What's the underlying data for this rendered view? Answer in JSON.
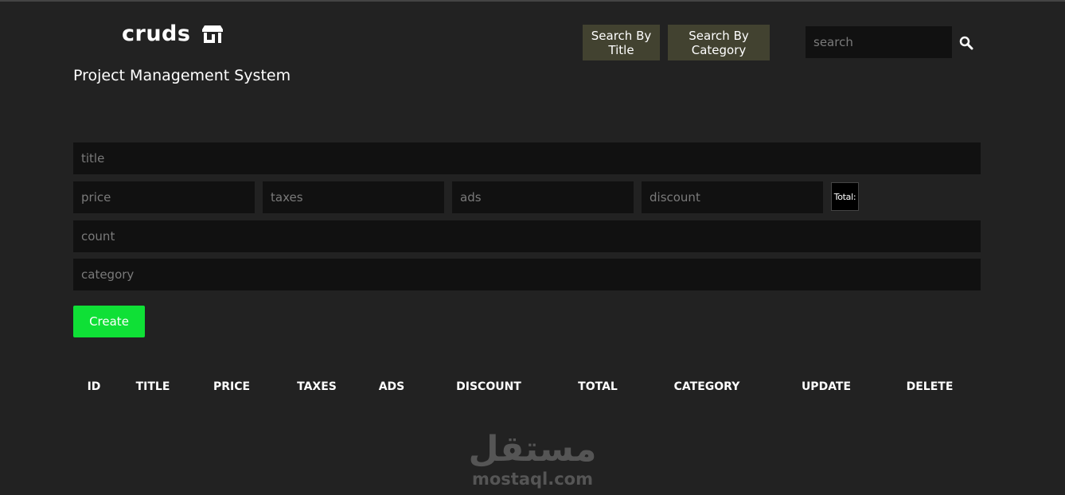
{
  "header": {
    "logo_text": "cruds",
    "logo_icon": "store-icon",
    "subtitle": "Project Management System",
    "search_by_title_label": "Search By Title",
    "search_by_category_label": "Search By Category",
    "search_placeholder": "search",
    "search_icon": "search-icon"
  },
  "form": {
    "title_placeholder": "title",
    "price_placeholder": "price",
    "taxes_placeholder": "taxes",
    "ads_placeholder": "ads",
    "discount_placeholder": "discount",
    "total_label": "Total:",
    "count_placeholder": "count",
    "category_placeholder": "category",
    "create_label": "Create"
  },
  "table": {
    "headers": [
      "ID",
      "TITLE",
      "PRICE",
      "TAXES",
      "ADS",
      "DISCOUNT",
      "TOTAL",
      "CATEGORY",
      "UPDATE",
      "DELETE"
    ]
  },
  "watermark": {
    "arabic": "مستقل",
    "domain": "mostaql.com"
  },
  "colors": {
    "background": "#222222",
    "input_background": "#111111",
    "nav_button": "#424230",
    "create_button": "#0fe036",
    "text": "#ffffff"
  }
}
